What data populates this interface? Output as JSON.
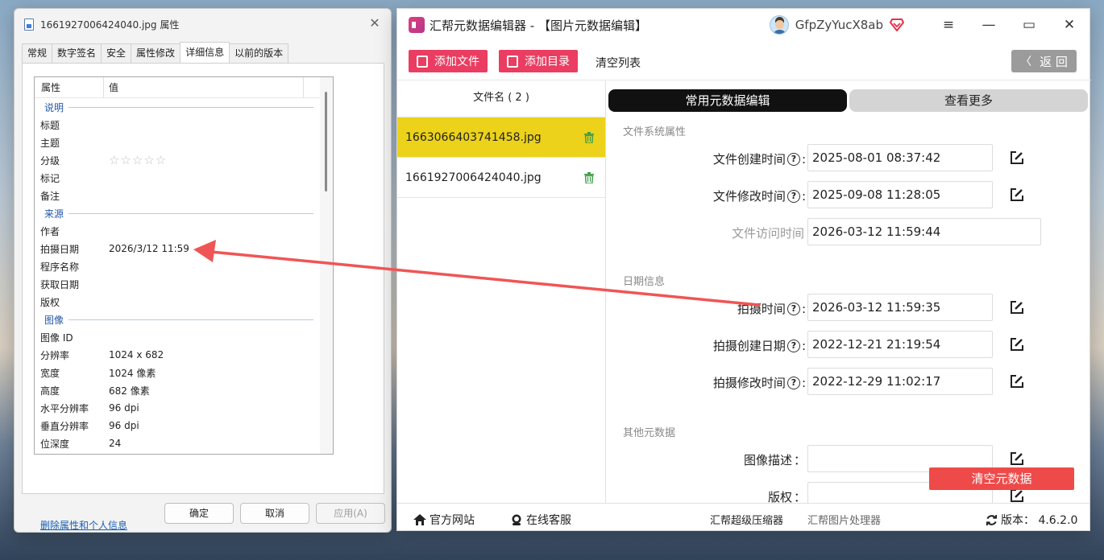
{
  "props_dialog": {
    "title": "1661927006424040.jpg 属性",
    "tabs": [
      "常规",
      "数字签名",
      "安全",
      "属性修改",
      "详细信息",
      "以前的版本"
    ],
    "active_tab": "详细信息",
    "col_property": "属性",
    "col_value": "值",
    "groups": {
      "description": "说明",
      "origin": "来源",
      "image": "图像"
    },
    "description_rows": [
      {
        "k": "标题",
        "v": ""
      },
      {
        "k": "主题",
        "v": ""
      },
      {
        "k": "分级",
        "v": "☆☆☆☆☆"
      },
      {
        "k": "标记",
        "v": ""
      },
      {
        "k": "备注",
        "v": ""
      }
    ],
    "origin_rows": [
      {
        "k": "作者",
        "v": ""
      },
      {
        "k": "拍摄日期",
        "v": "2026/3/12 11:59"
      },
      {
        "k": "程序名称",
        "v": ""
      },
      {
        "k": "获取日期",
        "v": ""
      },
      {
        "k": "版权",
        "v": ""
      }
    ],
    "image_rows": [
      {
        "k": "图像 ID",
        "v": ""
      },
      {
        "k": "分辨率",
        "v": "1024 x 682"
      },
      {
        "k": "宽度",
        "v": "1024 像素"
      },
      {
        "k": "高度",
        "v": "682 像素"
      },
      {
        "k": "水平分辨率",
        "v": "96 dpi"
      },
      {
        "k": "垂直分辨率",
        "v": "96 dpi"
      },
      {
        "k": "位深度",
        "v": "24"
      }
    ],
    "remove_link": "删除属性和个人信息",
    "ok": "确定",
    "cancel": "取消",
    "apply": "应用(A)"
  },
  "app": {
    "title": "汇帮元数据编辑器 - 【图片元数据编辑】",
    "user_name": "GfpZyYucX8ab",
    "toolbar": {
      "add_file": "添加文件",
      "add_dir": "添加目录",
      "clear_list": "清空列表",
      "back": "返 回"
    },
    "file_list": {
      "header": "文件名 ( 2 )",
      "files": [
        "1663066403741458.jpg",
        "1661927006424040.jpg"
      ]
    },
    "tabs": {
      "common": "常用元数据编辑",
      "more": "查看更多"
    },
    "sections": {
      "fs": "文件系统属性",
      "date": "日期信息",
      "other": "其他元数据"
    },
    "fields": {
      "created": {
        "label": "文件创建时间",
        "value": "2025-08-01 08:37:42"
      },
      "modified": {
        "label": "文件修改时间",
        "value": "2025-09-08 11:28:05"
      },
      "accessed": {
        "label": "文件访问时间",
        "value": "2026-03-12 11:59:44"
      },
      "taken": {
        "label": "拍摄时间",
        "value": "2026-03-12 11:59:35"
      },
      "taken_created": {
        "label": "拍摄创建日期",
        "value": "2022-12-21 21:19:54"
      },
      "taken_modified": {
        "label": "拍摄修改时间",
        "value": "2022-12-29 11:02:17"
      },
      "desc": {
        "label": "图像描述",
        "value": ""
      },
      "copyright": {
        "label": "版权",
        "value": ""
      }
    },
    "clear_meta": "清空元数据",
    "status": {
      "site": "官方网站",
      "service": "在线客服",
      "compressor": "汇帮超级压缩器",
      "image_tool": "汇帮图片处理器",
      "version": "版本： 4.6.2.0"
    }
  },
  "colors": {
    "accent_pink": "#ea3d61",
    "selected_row": "#ecd21a",
    "arrow": "#f05555"
  }
}
